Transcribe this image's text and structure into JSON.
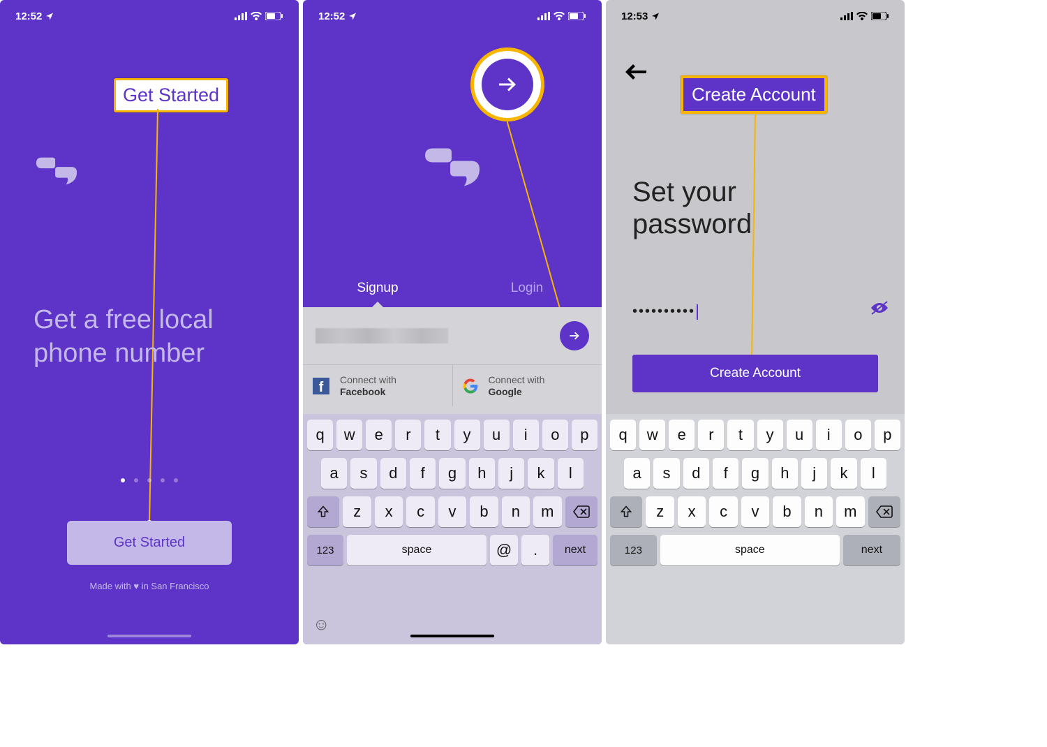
{
  "status_bar": {
    "time_a": "12:52",
    "time_b": "12:53"
  },
  "phone1": {
    "highlight_label": "Get Started",
    "hero_text_l1": "Get a free local",
    "hero_text_l2": "phone number",
    "button_label": "Get Started",
    "footer_text": "Made with ♥ in San Francisco"
  },
  "phone2": {
    "tabs": {
      "signup": "Signup",
      "login": "Login"
    },
    "social": {
      "connect_prefix": "Connect with",
      "facebook": "Facebook",
      "google": "Google"
    }
  },
  "phone3": {
    "title_l1": "Set your",
    "title_l2": "password",
    "password_masked": "••••••••••",
    "button_label": "Create Account",
    "highlight_label": "Create Account"
  },
  "keyboard": {
    "row1": [
      "q",
      "w",
      "e",
      "r",
      "t",
      "y",
      "u",
      "i",
      "o",
      "p"
    ],
    "row2": [
      "a",
      "s",
      "d",
      "f",
      "g",
      "h",
      "j",
      "k",
      "l"
    ],
    "row3": [
      "z",
      "x",
      "c",
      "v",
      "b",
      "n",
      "m"
    ],
    "num_key": "123",
    "space_key": "space",
    "at_key": "@",
    "dot_key": ".",
    "next_key": "next"
  }
}
